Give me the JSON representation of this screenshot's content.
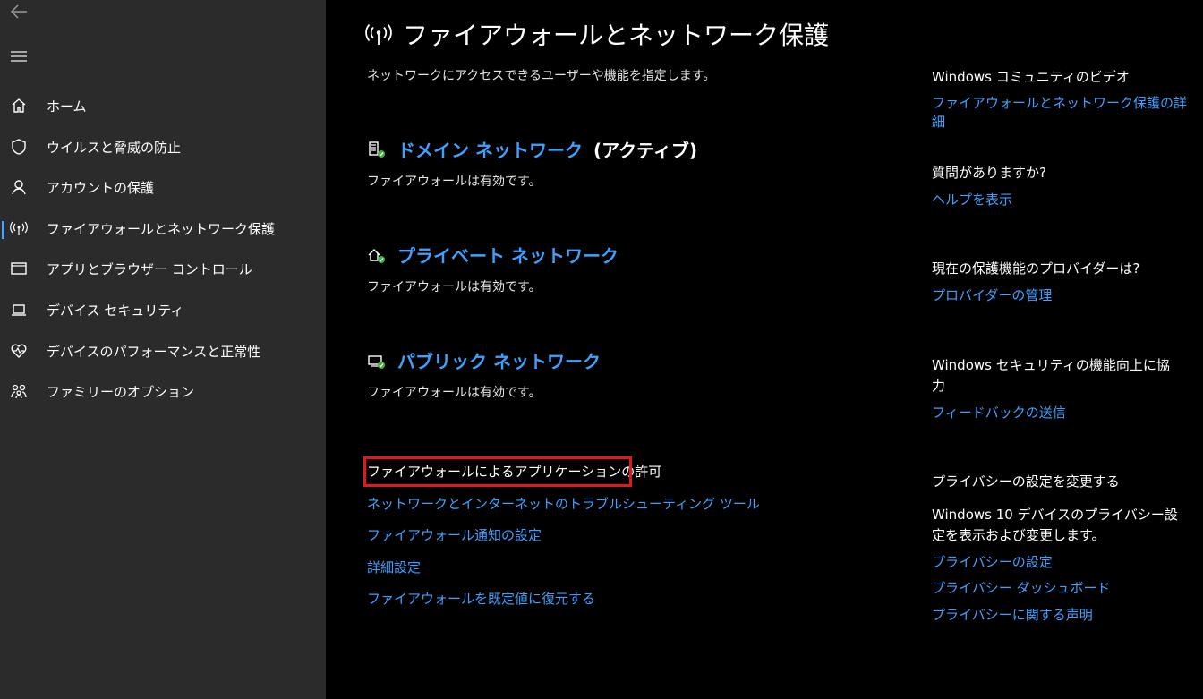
{
  "sidebar": {
    "items": [
      {
        "label": "ホーム",
        "icon": "home-icon"
      },
      {
        "label": "ウイルスと脅威の防止",
        "icon": "shield-icon"
      },
      {
        "label": "アカウントの保護",
        "icon": "person-icon"
      },
      {
        "label": "ファイアウォールとネットワーク保護",
        "icon": "wifi-antenna-icon",
        "active": true
      },
      {
        "label": "アプリとブラウザー コントロール",
        "icon": "browser-window-icon"
      },
      {
        "label": "デバイス セキュリティ",
        "icon": "laptop-icon"
      },
      {
        "label": "デバイスのパフォーマンスと正常性",
        "icon": "heart-pulse-icon"
      },
      {
        "label": "ファミリーのオプション",
        "icon": "family-icon"
      }
    ],
    "active_accent": "#4da3ff"
  },
  "main": {
    "title": "ファイアウォールとネットワーク保護",
    "description": "ネットワークにアクセスできるユーザーや機能を指定します。",
    "networks": [
      {
        "name": "ドメイン ネットワーク",
        "status": "(アクティブ)",
        "sub": "ファイアウォールは有効です。",
        "icon": "domain-network-icon"
      },
      {
        "name": "プライベート ネットワーク",
        "status": "",
        "sub": "ファイアウォールは有効です。",
        "icon": "private-network-icon"
      },
      {
        "name": "パブリック ネットワーク",
        "status": "",
        "sub": "ファイアウォールは有効です。",
        "icon": "public-network-icon"
      }
    ],
    "allow_app": "ファイアウォールによるアプリケーションの許可",
    "links": [
      "ネットワークとインターネットのトラブルシューティング ツール",
      "ファイアウォール通知の設定",
      "詳細設定",
      "ファイアウォールを既定値に復元する"
    ]
  },
  "right": {
    "community_head": "Windows コミュニティのビデオ",
    "community_link": "ファイアウォールとネットワーク保護の詳細",
    "question_head": "質問がありますか?",
    "question_link": "ヘルプを表示",
    "provider_head": "現在の保護機能のプロバイダーは?",
    "provider_link": "プロバイダーの管理",
    "improve_head": "Windows セキュリティの機能向上に協力",
    "improve_link": "フィードバックの送信",
    "privacy_head": "プライバシーの設定を変更する",
    "privacy_text": "Windows 10 デバイスのプライバシー設定を表示および変更します。",
    "privacy_links": [
      "プライバシーの設定",
      "プライバシー ダッシュボード",
      "プライバシーに関する声明"
    ]
  },
  "colors": {
    "link": "#3fa0ff",
    "highlight": "#e0191c",
    "ok_badge": "#3db33d"
  }
}
